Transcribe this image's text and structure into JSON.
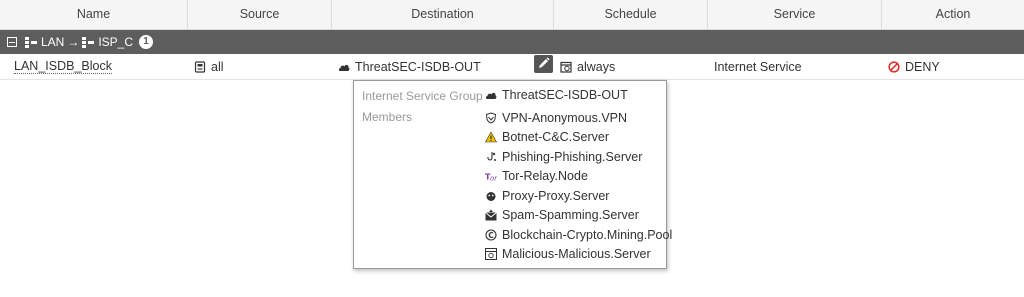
{
  "columns": {
    "name": "Name",
    "source": "Source",
    "destination": "Destination",
    "schedule": "Schedule",
    "service": "Service",
    "action": "Action"
  },
  "group": {
    "from": "LAN",
    "arrow": "→",
    "to": "ISP_C",
    "count": "1"
  },
  "row": {
    "name": "LAN_ISDB_Block",
    "source": "all",
    "destination": "ThreatSEC-ISDB-OUT",
    "schedule": "always",
    "service": "Internet Service",
    "action": "DENY"
  },
  "tooltip": {
    "group_label": "Internet Service Group",
    "group_value": "ThreatSEC-ISDB-OUT",
    "members_label": "Members",
    "members": [
      {
        "label": "VPN-Anonymous.VPN",
        "icon": "vpn-shield-icon"
      },
      {
        "label": "Botnet-C&C.Server",
        "icon": "warning-icon"
      },
      {
        "label": "Phishing-Phishing.Server",
        "icon": "phishing-hook-icon"
      },
      {
        "label": "Tor-Relay.Node",
        "icon": "tor-icon"
      },
      {
        "label": "Proxy-Proxy.Server",
        "icon": "proxy-icon"
      },
      {
        "label": "Spam-Spamming.Server",
        "icon": "spam-mail-icon"
      },
      {
        "label": "Blockchain-Crypto.Mining.Pool",
        "icon": "crypto-coin-icon"
      },
      {
        "label": "Malicious-Malicious.Server",
        "icon": "malicious-server-icon"
      }
    ]
  },
  "colors": {
    "group_bar": "#5d5d5d",
    "header_bg": "#f5f5f5",
    "deny_red": "#d9342b"
  }
}
